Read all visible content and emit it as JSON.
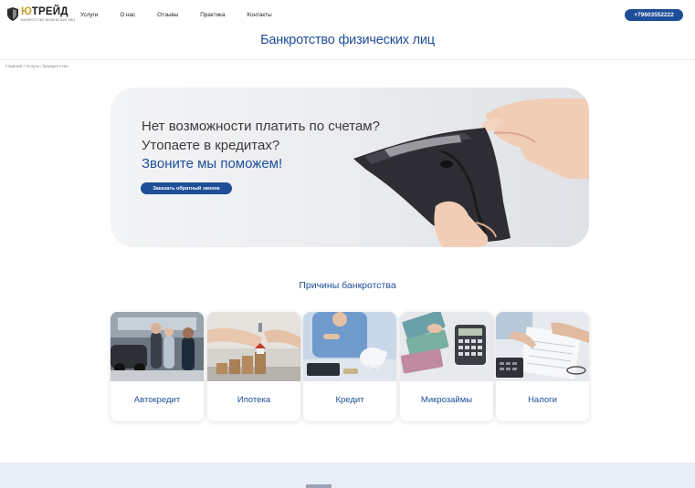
{
  "header": {
    "logo": {
      "name_part1": "Ю",
      "name_part2": "ТРЕЙД",
      "subtitle": "БАНКРОТСТВО ФИЗИЧЕСКИХ ЛИЦ"
    },
    "nav": [
      "Услуги",
      "О нас",
      "Отзывы",
      "Практика",
      "Контакты"
    ],
    "phone": "+79603552222"
  },
  "page_title": "Банкротство физических лиц",
  "breadcrumb": "Главная / Услуги / Банкротство",
  "hero": {
    "line1": "Нет возможности платить по счетам?",
    "line2": "Утопаете в кредитах?",
    "line3": "Звоните мы поможем!",
    "button": "Заказать обратный звонок"
  },
  "reasons": {
    "title": "Причины банкротства",
    "cards": [
      {
        "label": "Автокредит",
        "icon": "car-dealer-photo"
      },
      {
        "label": "Ипотека",
        "icon": "house-keys-photo"
      },
      {
        "label": "Кредит",
        "icon": "piggy-bank-photo"
      },
      {
        "label": "Микрозаймы",
        "icon": "money-calculator-photo"
      },
      {
        "label": "Налоги",
        "icon": "tax-documents-photo"
      }
    ]
  },
  "colors": {
    "accent": "#1f4e99",
    "logo_gold": "#c9a02b",
    "footer_band": "#e8eef8"
  }
}
